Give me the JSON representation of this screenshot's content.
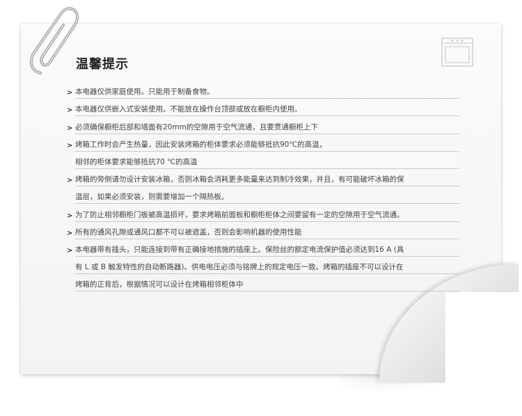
{
  "title": "温馨提示",
  "bullet_glyph": ">",
  "items": [
    {
      "lines": [
        "本电器仅供家庭使用。只能用于制备食物。"
      ]
    },
    {
      "lines": [
        "本电器仅供嵌入式安装使用。不能放在操作台顶部或放在橱柜内使用。"
      ]
    },
    {
      "lines": [
        "必须确保橱柜后部和墙面有20mm的空隙用于空气流通，且要贯通橱柜上下"
      ]
    },
    {
      "lines": [
        "烤箱工作时会产生热量，因此安装烤箱的柜体要求必须能够抵抗90℃的高温，",
        "相邻的柜体要求能够抵抗70 ℃的高温"
      ]
    },
    {
      "lines": [
        "烤箱的旁侧请勿设计安装冰箱，否则冰箱会消耗更多能量来达到制冷效果，并且，有可能破坏冰箱的保",
        "温层，如果必须安装，则需要增加一个隔热板。"
      ]
    },
    {
      "lines": [
        "为了防止相邻橱柜门板被高温损坏，要求烤箱前面板和橱柜柜体之间要留有一定的空隙用于空气流通。"
      ]
    },
    {
      "lines": [
        "所有的通风孔隙或通风口都不可以被遮盖，否则会影响机器的使用性能"
      ]
    },
    {
      "lines": [
        "本电器带有插头，只能连接到带有正确接地措施的插座上。保险丝的额定电流保护值必须达到16 A (具",
        "有 L 或 B 触发特性的自动断路器)。供电电压必须与铭牌上的规定电压一致。烤箱的插座不可以设计在",
        "烤箱的正背后，根据情况可以设计在烤箱相邻柜体中"
      ]
    }
  ]
}
